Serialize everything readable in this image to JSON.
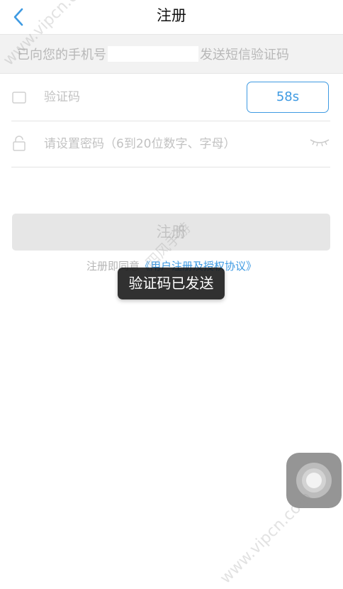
{
  "nav": {
    "title": "注册",
    "back_icon": "chevron-left-icon"
  },
  "notice": {
    "prefix": "已向您的手机号",
    "suffix": "发送短信验证码"
  },
  "form": {
    "code_placeholder": "验证码",
    "countdown_label": "58s",
    "password_placeholder": "请设置密码（6到20位数字、字母）"
  },
  "submit_label": "注册",
  "agreement": {
    "prefix": "注册即同意",
    "link": "《用户注册及授权协议》"
  },
  "toast": "验证码已发送",
  "watermark": {
    "top": "www.vipcn.com",
    "middle": "四风手游",
    "bottom": "www.vipcn.com"
  },
  "colors": {
    "accent": "#3e9ae2",
    "disabled_button": "#e6e6e6",
    "notice_bg": "#f2f2f2"
  }
}
